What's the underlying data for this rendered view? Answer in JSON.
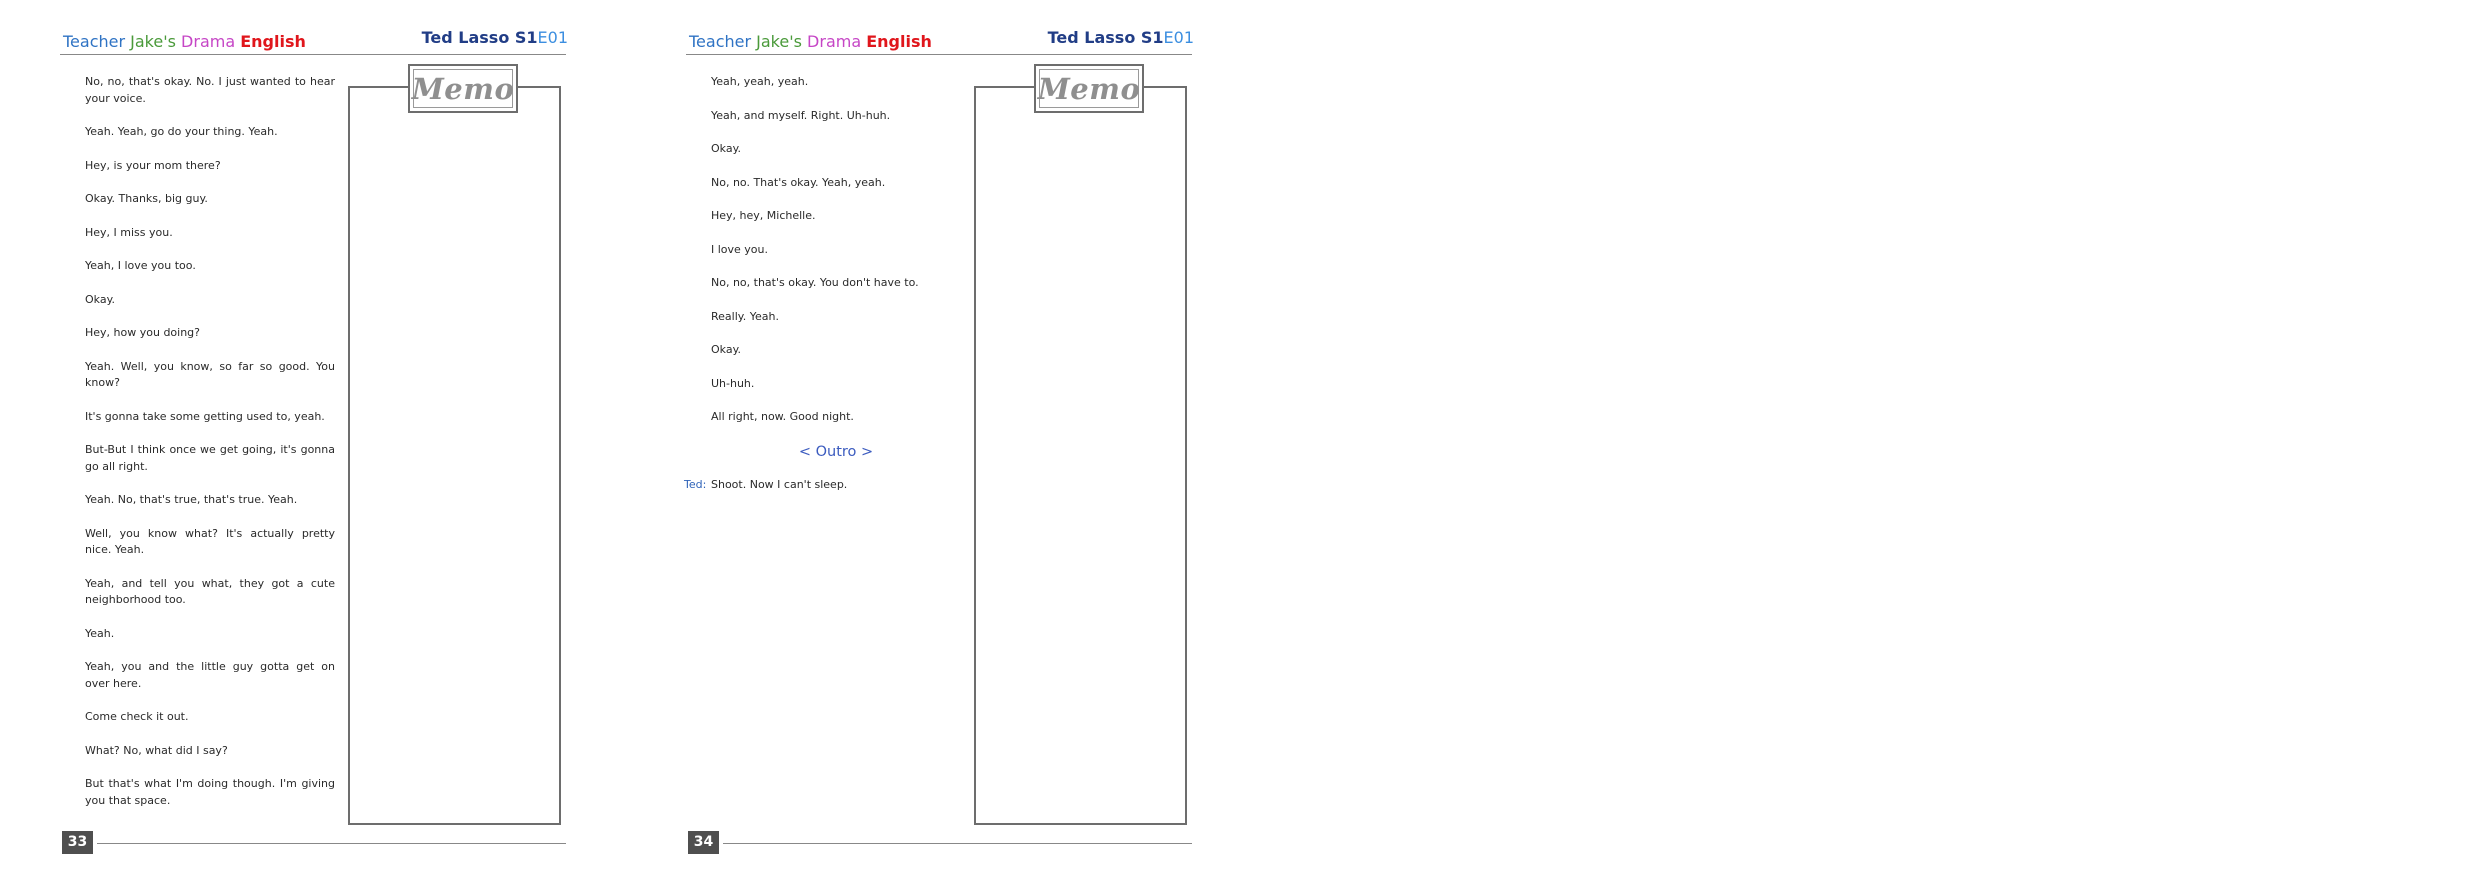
{
  "header": {
    "brand": {
      "word1": "Teacher",
      "word2": "Jake's",
      "word3": "Drama",
      "word4": "English"
    },
    "title": "Ted Lasso ",
    "episode_season": "S1",
    "episode_number": "E01"
  },
  "memo_label": "Memo",
  "pages": {
    "left": {
      "number": "33",
      "lines": [
        "No, no, that's okay. No. I just wanted to hear your voice.",
        "Yeah. Yeah, go do your thing. Yeah.",
        "Hey, is your mom there?",
        "Okay. Thanks, big guy.",
        "Hey, I miss you.",
        "Yeah, I love you too.",
        "Okay.",
        "Hey, how you doing?",
        "Yeah. Well, you know, so far so good. You know?",
        "It's gonna take some getting used to, yeah.",
        "But-But I think once we get going, it's gonna go all right.",
        "Yeah. No, that's true, that's true. Yeah.",
        "Well, you know what? It's actually pretty nice. Yeah.",
        "Yeah, and tell you what, they got a cute neighborhood too.",
        "Yeah.",
        "Yeah, you and the little guy gotta get on over here.",
        "Come check it out.",
        "What? No, what did I say?",
        "But that's what I'm doing though. I'm giving you that space."
      ]
    },
    "right": {
      "number": "34",
      "lines": [
        "Yeah, yeah, yeah.",
        "Yeah, and myself. Right. Uh-huh.",
        "Okay.",
        "No, no. That's okay. Yeah, yeah.",
        "Hey, hey, Michelle.",
        "I love you.",
        "No, no, that's okay. You don't have to.",
        "Really. Yeah.",
        "Okay.",
        "Uh-huh.",
        "All right, now. Good night."
      ],
      "section_heading": "< Outro >",
      "final_line": {
        "speaker": "Ted:",
        "text": "Shoot. Now I can't sleep."
      }
    }
  }
}
